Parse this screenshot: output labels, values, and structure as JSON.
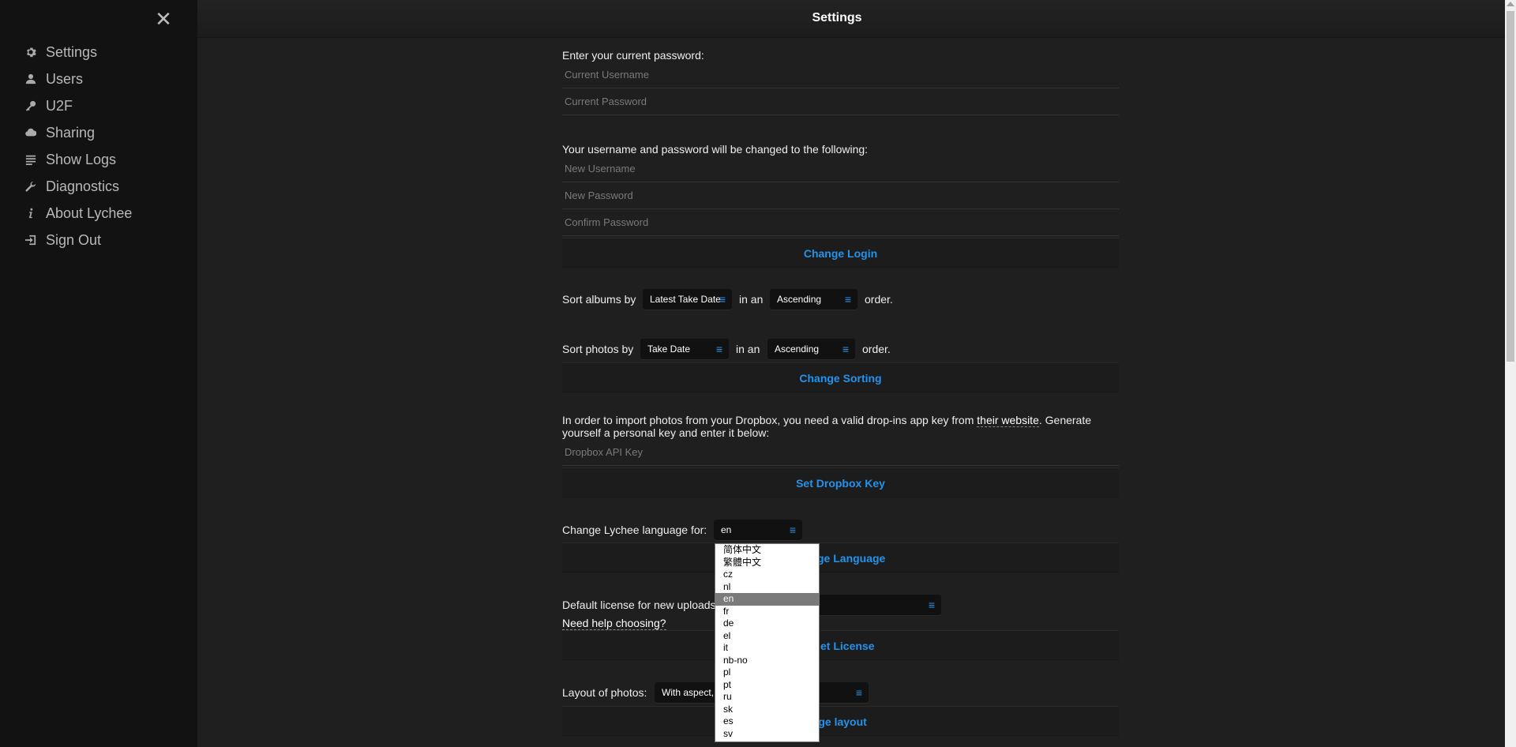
{
  "header": {
    "title": "Settings"
  },
  "sidebar": {
    "close_icon": "close-icon",
    "items": [
      {
        "label": "Settings",
        "icon": "gear-icon"
      },
      {
        "label": "Users",
        "icon": "user-icon"
      },
      {
        "label": "U2F",
        "icon": "key-icon"
      },
      {
        "label": "Sharing",
        "icon": "cloud-icon"
      },
      {
        "label": "Show Logs",
        "icon": "list-icon"
      },
      {
        "label": "Diagnostics",
        "icon": "wrench-icon"
      },
      {
        "label": "About Lychee",
        "icon": "info-icon"
      },
      {
        "label": "Sign Out",
        "icon": "signout-icon"
      }
    ]
  },
  "login": {
    "current_prompt": "Enter your current password:",
    "current_username_placeholder": "Current Username",
    "current_password_placeholder": "Current Password",
    "new_prompt": "Your username and password will be changed to the following:",
    "new_username_placeholder": "New Username",
    "new_password_placeholder": "New Password",
    "confirm_password_placeholder": "Confirm Password",
    "button": "Change Login"
  },
  "sorting": {
    "albums_label": "Sort albums by",
    "albums_by": "Latest Take Date",
    "in_an": "in an",
    "albums_order": "Ascending",
    "order_suffix": "order.",
    "photos_label": "Sort photos by",
    "photos_by": "Take Date",
    "photos_order": "Ascending",
    "button": "Change Sorting"
  },
  "dropbox": {
    "text_before": "In order to import photos from your Dropbox, you need a valid drop-ins app key from",
    "link": "their website",
    "text_after": ". Generate yourself a personal key and enter it below:",
    "placeholder": "Dropbox API Key",
    "button": "Set Dropbox Key"
  },
  "language": {
    "label": "Change Lychee language for:",
    "selected": "en",
    "button_visible": "ge Language",
    "options": [
      "简体中文",
      "繁體中文",
      "cz",
      "nl",
      "en",
      "fr",
      "de",
      "el",
      "it",
      "nb-no",
      "pl",
      "pt",
      "ru",
      "sk",
      "es",
      "sv"
    ],
    "selected_index": 4
  },
  "license": {
    "label_visible": "Default license for new uploads",
    "help_link": "Need help choosing?",
    "button_visible": "et License"
  },
  "layout": {
    "label": "Layout of photos:",
    "selected_visible": "With aspect,",
    "button_visible": "ange layout"
  }
}
